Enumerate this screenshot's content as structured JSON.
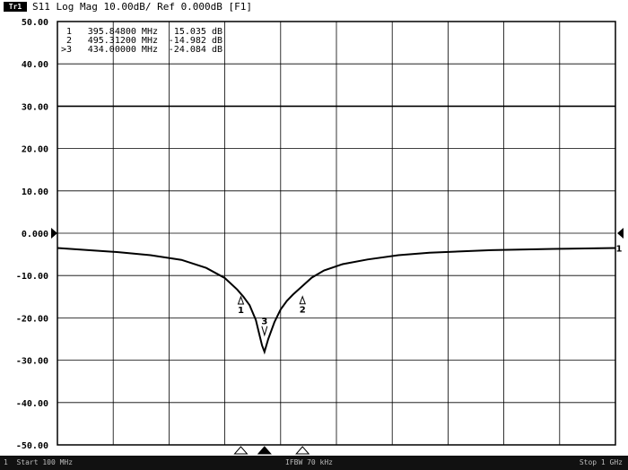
{
  "header": {
    "trace_badge": "Tr1",
    "trace_title": "S11 Log Mag 10.00dB/ Ref 0.000dB [F1]"
  },
  "marker_table": [
    {
      "id": "1",
      "freq": "395.84800 MHz",
      "value": "15.035 dB"
    },
    {
      "id": "2",
      "freq": "495.31200 MHz",
      "value": "-14.982 dB"
    },
    {
      "id": ">3",
      "freq": "434.00000 MHz",
      "value": "-24.084 dB"
    }
  ],
  "footer": {
    "start": "1  Start 100 MHz",
    "center": "IFBW 70 kHz",
    "stop": "Stop 1 GHz"
  },
  "colors": {
    "background": "#ffffff",
    "grid": "#000000",
    "trace": "#000000",
    "footer_bg": "#111111"
  },
  "icons": [
    "reference-level-arrow-icon",
    "stimulus-marker-triangle-icon"
  ],
  "chart_data": {
    "type": "line",
    "title": "",
    "xlabel": "",
    "ylabel": "",
    "ylim": [
      -50,
      50
    ],
    "xlim": [
      100,
      1000
    ],
    "x_unit": "MHz",
    "y_unit": "dB",
    "y_ticks": [
      "50.00",
      "40.00",
      "30.00",
      "20.00",
      "10.00",
      "0.000",
      "-10.00",
      "-20.00",
      "-30.00",
      "-40.00",
      "-50.00"
    ],
    "grid": true,
    "reference_value": 0,
    "series": [
      {
        "x": [
          100,
          150,
          200,
          250,
          300,
          340,
          370,
          390,
          400,
          410,
          420,
          425,
          430,
          434,
          440,
          450,
          460,
          470,
          480,
          495,
          510,
          530,
          560,
          600,
          650,
          700,
          800,
          900,
          1000
        ],
        "values": [
          -3.5,
          -4.0,
          -4.5,
          -5.2,
          -6.3,
          -8.2,
          -10.6,
          -13.3,
          -15.0,
          -17.0,
          -20.5,
          -23.5,
          -26.5,
          -28.0,
          -25.0,
          -21.0,
          -18.0,
          -16.0,
          -14.5,
          -12.5,
          -10.5,
          -8.8,
          -7.3,
          -6.2,
          -5.2,
          -4.6,
          -4.0,
          -3.7,
          -3.5
        ]
      }
    ],
    "markers": [
      {
        "label": "1",
        "x": 395.848,
        "y": -15.035
      },
      {
        "label": "2",
        "x": 495.312,
        "y": -14.982
      },
      {
        "label": "3",
        "x": 434.0,
        "y": -24.084
      }
    ],
    "stimulus_markers": [
      395.848,
      434.0,
      495.312
    ],
    "end_marker_label": "1"
  }
}
